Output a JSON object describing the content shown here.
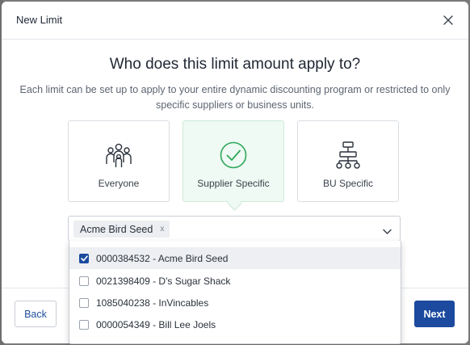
{
  "modal": {
    "title": "New Limit",
    "question": "Who does this limit amount apply to?",
    "description": "Each limit can be set up to apply to your entire dynamic discounting program or restricted to only specific suppliers or business units."
  },
  "options": [
    {
      "label": "Everyone",
      "icon": "people-group-icon",
      "selected": false
    },
    {
      "label": "Supplier Specific",
      "icon": "check-circle-icon",
      "selected": true
    },
    {
      "label": "BU Specific",
      "icon": "org-chart-icon",
      "selected": false
    }
  ],
  "supplier_select": {
    "selected_tags": [
      {
        "label": "Acme Bird Seed",
        "remove": "x"
      }
    ],
    "items": [
      {
        "label": "0000384532 - Acme Bird Seed",
        "checked": true
      },
      {
        "label": "0021398409 - D's Sugar Shack",
        "checked": false
      },
      {
        "label": "1085040238 - InVincables",
        "checked": false
      },
      {
        "label": "0000054349 - Bill Lee Joels",
        "checked": false
      }
    ]
  },
  "footer": {
    "back_label": "Back",
    "next_label": "Next"
  },
  "colors": {
    "primary": "#1b4a9e",
    "selected_card_bg": "#eefaf3",
    "success_green": "#2fa75a"
  }
}
